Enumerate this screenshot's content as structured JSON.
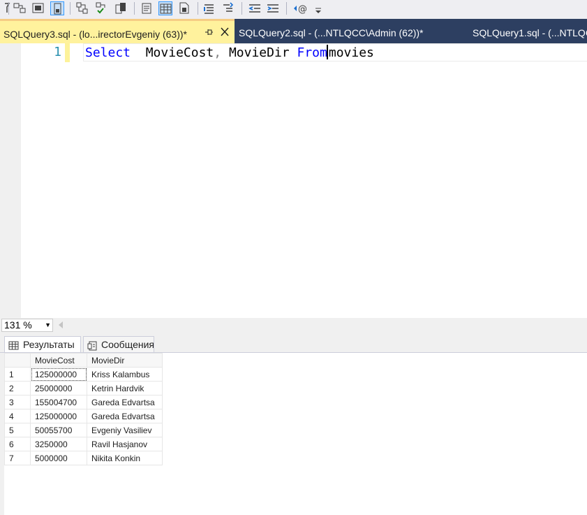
{
  "toolbar": {
    "icons": [
      "filter-icon",
      "table-icon",
      "window-icon",
      "grid-icon",
      "diagram-icon",
      "check-diagram-icon",
      "server-icon",
      "results-text-icon",
      "results-grid-icon",
      "results-file-icon",
      "comment-icon",
      "uncomment-icon",
      "outdent-icon",
      "indent-icon",
      "template-icon",
      "overflow-icon"
    ]
  },
  "tabs": [
    {
      "label": "SQLQuery3.sql - (lo...irectorEvgeniy (63))*",
      "active": true
    },
    {
      "label": "SQLQuery2.sql - (...NTLQCC\\Admin (62))*",
      "active": false
    },
    {
      "label": "SQLQuery1.sql - (...NTLQC",
      "active": false
    }
  ],
  "editor": {
    "line_number": "1",
    "code": {
      "kw_select": "Select",
      "col1": "MovieCost",
      "comma": ",",
      "col2": "MovieDir",
      "kw_from": "From",
      "table": "movies"
    }
  },
  "zoom": {
    "value": "131 %"
  },
  "results_tabs": [
    {
      "label": "Результаты",
      "icon": "grid-icon"
    },
    {
      "label": "Сообщения",
      "icon": "message-icon"
    }
  ],
  "grid": {
    "columns": [
      "MovieCost",
      "MovieDir"
    ],
    "rows": [
      {
        "n": "1",
        "cost": "125000000",
        "dir": "Kriss Kalambus"
      },
      {
        "n": "2",
        "cost": "25000000",
        "dir": "Ketrin Hardvik"
      },
      {
        "n": "3",
        "cost": "155004700",
        "dir": "Gareda Edvartsa"
      },
      {
        "n": "4",
        "cost": "125000000",
        "dir": "Gareda Edvartsa"
      },
      {
        "n": "5",
        "cost": "50055700",
        "dir": "Evgeniy Vasiliev"
      },
      {
        "n": "6",
        "cost": "3250000",
        "dir": "Ravil Hasjanov"
      },
      {
        "n": "7",
        "cost": "5000000",
        "dir": "Nikita Konkin"
      }
    ]
  },
  "colors": {
    "accent": "#2d3f61",
    "active_tab": "#fff29d",
    "keyword": "#0000ff",
    "line_number": "#2b91af"
  }
}
